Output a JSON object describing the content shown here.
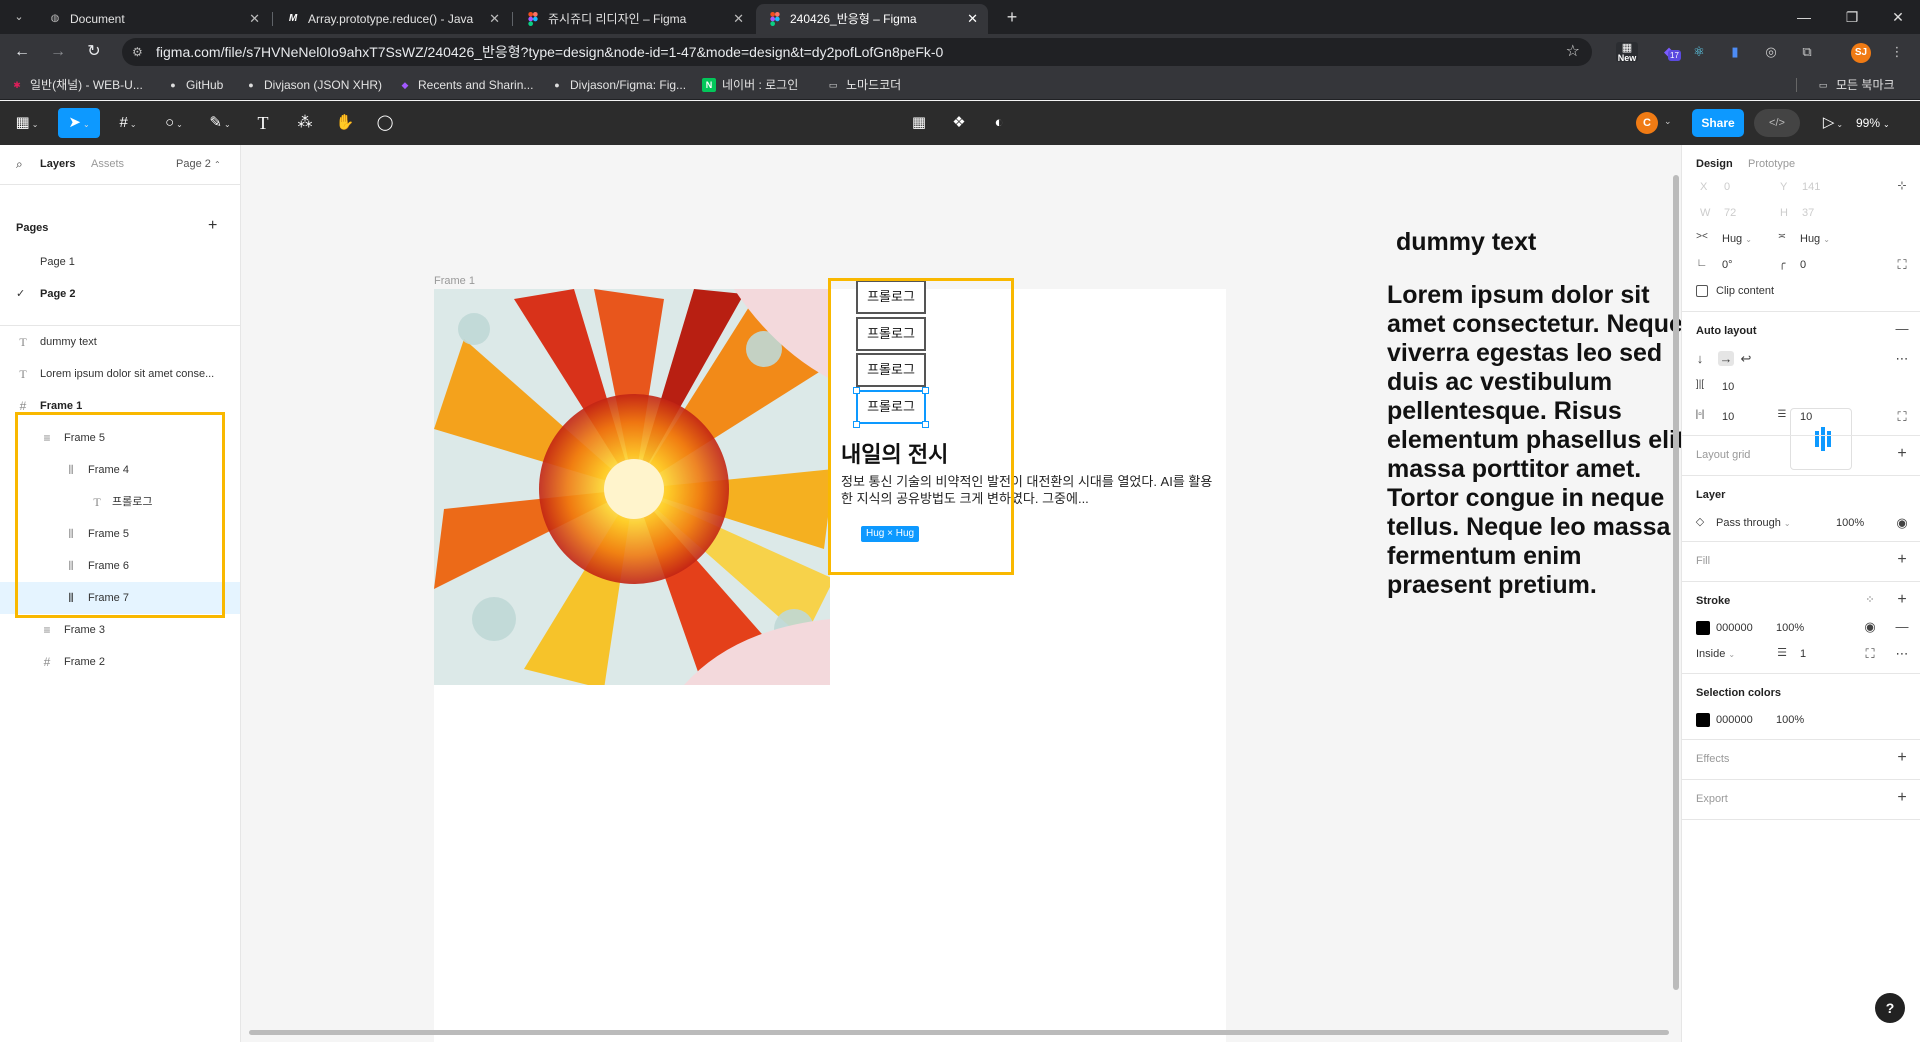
{
  "browser": {
    "tabs": [
      {
        "title": "Document",
        "favicon": "globe-icon"
      },
      {
        "title": "Array.prototype.reduce() - Java",
        "favicon": "M"
      },
      {
        "title": "쥬시쥬디 리디자인 – Figma",
        "favicon": "figma-icon"
      },
      {
        "title": "240426_반응형 – Figma",
        "favicon": "figma-icon"
      }
    ],
    "url": "figma.com/file/s7HVNeNel0Io9ahxT7SsWZ/240426_반응형?type=design&node-id=1-47&mode=design&t=dy2pofLofGn8peFk-0",
    "ext_new_label": "New",
    "ext_badge_count": "17",
    "profile_initials": "SJ",
    "bookmarks": [
      {
        "label": "일반(채널) - WEB-U...",
        "icon": "slack-icon"
      },
      {
        "label": "GitHub",
        "icon": "github-icon"
      },
      {
        "label": "Divjason (JSON XHR)",
        "icon": "github-icon"
      },
      {
        "label": "Recents and Sharin...",
        "icon": "figma-icon"
      },
      {
        "label": "Divjason/Figma: Fig...",
        "icon": "github-icon"
      },
      {
        "label": "네이버 : 로그인",
        "icon": "N"
      },
      {
        "label": "노마드코더",
        "icon": "folder-icon"
      }
    ],
    "all_bookmarks": "모든 북마크"
  },
  "figma_toolbar": {
    "collaborator_initial": "C",
    "share_label": "Share",
    "zoom": "99%"
  },
  "left_panel": {
    "tabs": [
      "Layers",
      "Assets"
    ],
    "page_selector": "Page 2",
    "pages_title": "Pages",
    "pages": [
      "Page 1",
      "Page 2"
    ],
    "layers": [
      {
        "name": "dummy text",
        "icon": "T"
      },
      {
        "name": "Lorem ipsum dolor sit amet conse...",
        "icon": "T"
      },
      {
        "name": "Frame 1",
        "icon": "#"
      },
      {
        "name": "Frame 5",
        "icon": "≡"
      },
      {
        "name": "Frame 4",
        "icon": "⫴"
      },
      {
        "name": "프롤로그",
        "icon": "T"
      },
      {
        "name": "Frame 5",
        "icon": "⫴"
      },
      {
        "name": "Frame 6",
        "icon": "⫴"
      },
      {
        "name": "Frame 7",
        "icon": "⫴"
      },
      {
        "name": "Frame 3",
        "icon": "≡"
      },
      {
        "name": "Frame 2",
        "icon": "#"
      }
    ]
  },
  "canvas": {
    "frame_label": "Frame 1",
    "exhibit_title": "내일의 전시",
    "exhibit_body": "정보 통신 기술의 비약적인 발전이 대전환의 시대를 열었다. AI를 활용한 지식의 공유방법도 크게 변하였다. 그중에...",
    "buttons": [
      "프롤로그",
      "프롤로그",
      "프롤로그",
      "프롤로그"
    ],
    "size_badge": "Hug × Hug",
    "dummy_title": "dummy text",
    "lorem": "Lorem ipsum dolor sit amet consectetur. Neque viverra egestas leo sed duis ac vestibulum pellentesque. Risus elementum phasellus elit massa porttitor amet. Tortor congue in neque tellus. Neque leo massa fermentum enim praesent pretium."
  },
  "right_panel": {
    "tabs": [
      "Design",
      "Prototype"
    ],
    "x_label": "X",
    "x_val": "0",
    "y_label": "Y",
    "y_val": "141",
    "w_label": "W",
    "w_val": "72",
    "h_label": "H",
    "h_val": "37",
    "hug_w": "Hug",
    "hug_h": "Hug",
    "rotation": "0°",
    "radius": "0",
    "clip_content": "Clip content",
    "auto_layout": "Auto layout",
    "gap": "10",
    "pad_h": "10",
    "pad_v": "10",
    "layout_grid": "Layout grid",
    "layer": "Layer",
    "blend": "Pass through",
    "layer_opacity": "100%",
    "fill": "Fill",
    "stroke": "Stroke",
    "stroke_color": "000000",
    "stroke_opacity": "100%",
    "stroke_pos": "Inside",
    "stroke_weight": "1",
    "selection_colors": "Selection colors",
    "sel_color": "000000",
    "sel_opacity": "100%",
    "effects": "Effects",
    "export": "Export",
    "help": "?"
  },
  "colors": {
    "accent": "#0d99ff",
    "highlight": "#f9b800",
    "figma_dark": "#2c2c2c",
    "browser_dark": "#202124"
  }
}
